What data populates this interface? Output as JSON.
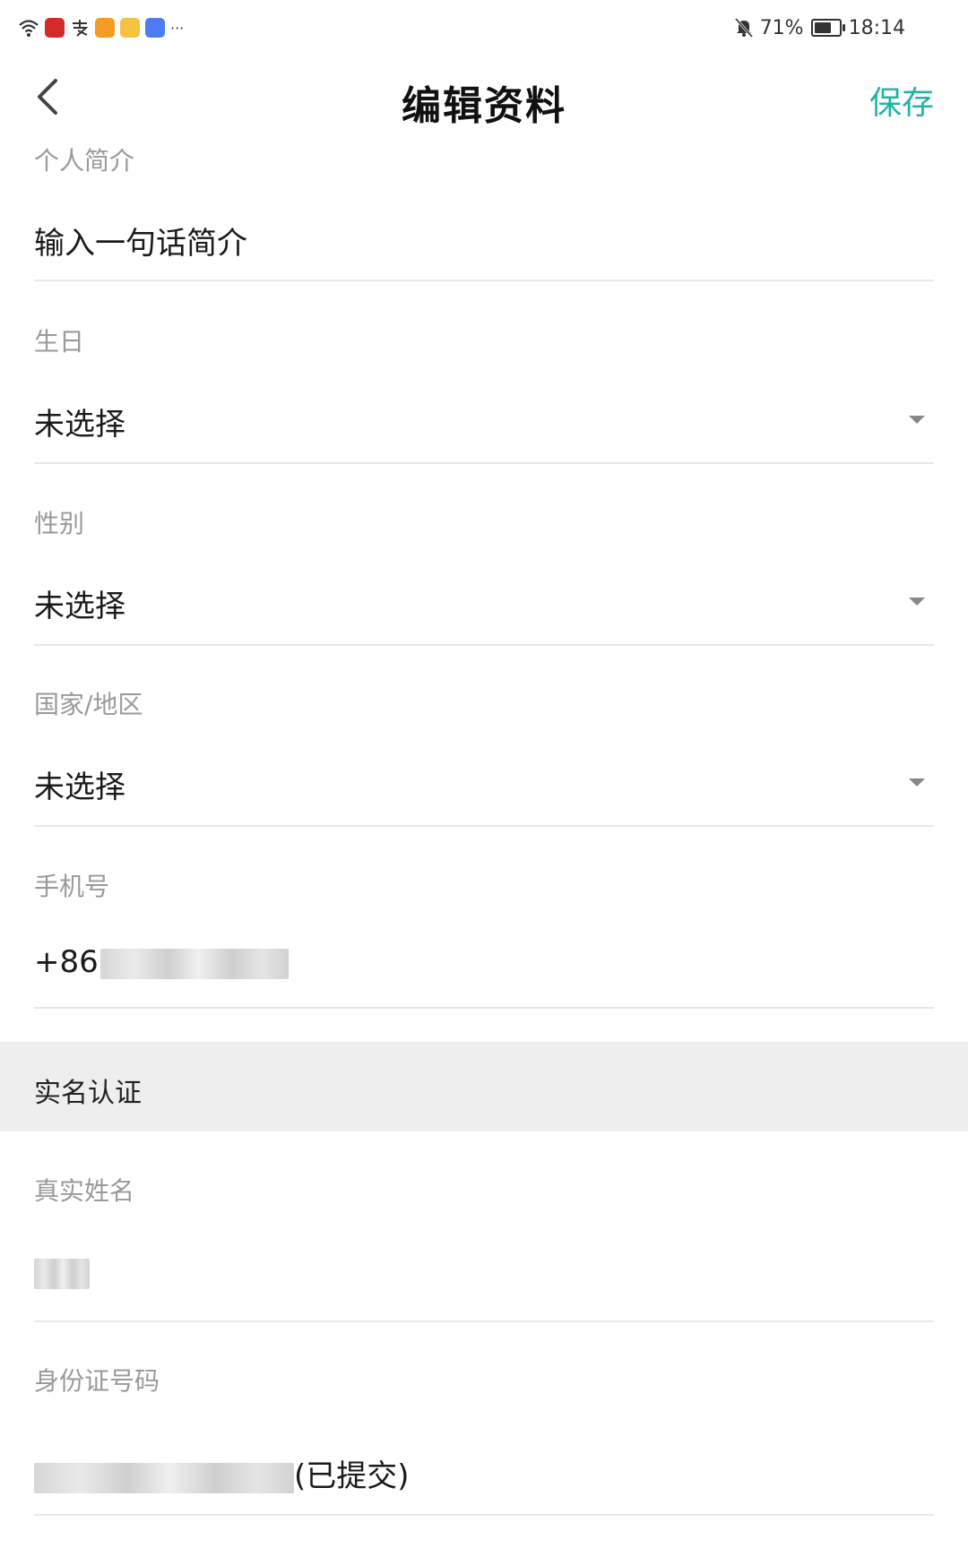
{
  "status_bar": {
    "battery_percent": "71%",
    "battery_level": 0.71,
    "time": "18:14",
    "left_icons": [
      "wifi-icon",
      "app-red-icon",
      "alipay-icon",
      "video-app-icon",
      "weibo-icon",
      "edu-app-icon",
      "more-icon"
    ],
    "right_icons": [
      "mute-bell-icon",
      "battery-icon"
    ],
    "more_dots": "···"
  },
  "header": {
    "title": "编辑资料",
    "save_label": "保存",
    "accent_color": "#22b3a4"
  },
  "form": {
    "bio": {
      "label": "个人简介",
      "placeholder": "输入一句话简介"
    },
    "birthday": {
      "label": "生日",
      "value": "未选择"
    },
    "gender": {
      "label": "性别",
      "value": "未选择"
    },
    "region": {
      "label": "国家/地区",
      "value": "未选择"
    },
    "phone": {
      "label": "手机号",
      "prefix": "+86"
    }
  },
  "real_name_section": {
    "title": "实名认证",
    "name": {
      "label": "真实姓名"
    },
    "id_number": {
      "label": "身份证号码",
      "status": "(已提交)"
    }
  }
}
